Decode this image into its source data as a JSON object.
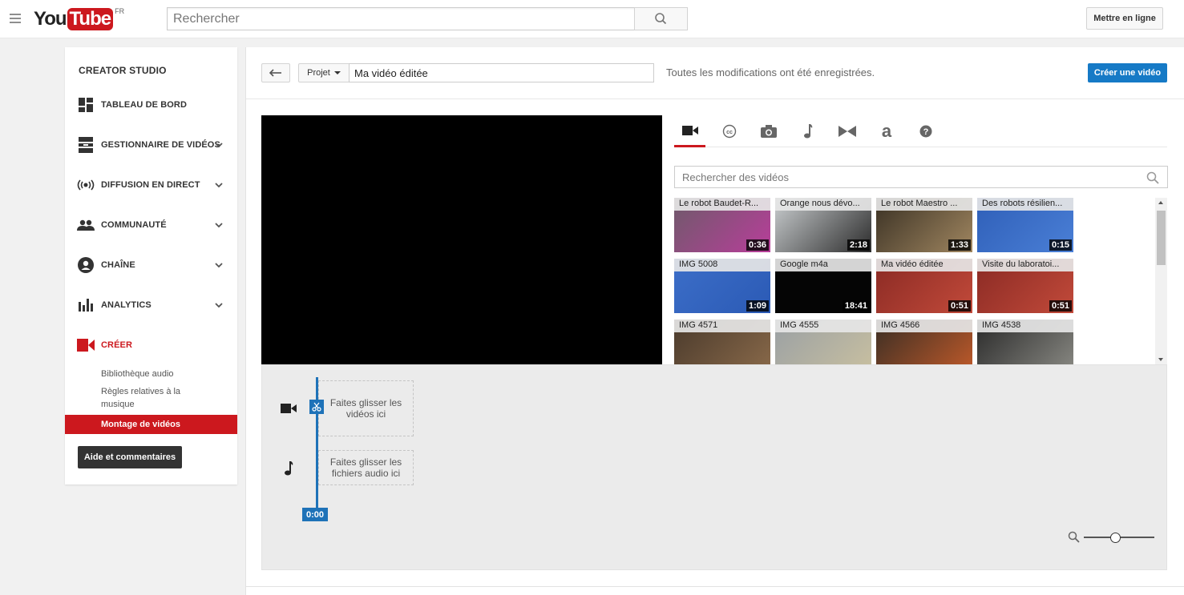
{
  "masthead": {
    "logo_you": "You",
    "logo_tube": "Tube",
    "logo_country": "FR",
    "search_placeholder": "Rechercher",
    "upload_label": "Mettre en ligne"
  },
  "sidebar": {
    "title": "CREATOR STUDIO",
    "items": [
      {
        "label": "TABLEAU DE BORD",
        "icon": "dashboard-icon",
        "has_chevron": false
      },
      {
        "label": "GESTIONNAIRE DE VIDÉOS",
        "icon": "video-manager-icon",
        "has_chevron": true
      },
      {
        "label": "DIFFUSION EN DIRECT",
        "icon": "live-broadcast-icon",
        "has_chevron": true
      },
      {
        "label": "COMMUNAUTÉ",
        "icon": "community-icon",
        "has_chevron": true
      },
      {
        "label": "CHAÎNE",
        "icon": "channel-icon",
        "has_chevron": true
      },
      {
        "label": "ANALYTICS",
        "icon": "analytics-icon",
        "has_chevron": true
      },
      {
        "label": "CRÉER",
        "icon": "create-video-icon",
        "has_chevron": false,
        "active": true
      }
    ],
    "sub_items": [
      {
        "label": "Bibliothèque audio"
      },
      {
        "label": "Règles relatives à la"
      },
      {
        "label": "musique"
      },
      {
        "label": "Montage de vidéos",
        "selected": true
      }
    ],
    "help_label": "Aide et commentaires"
  },
  "editor": {
    "project_label": "Projet",
    "title_value": "Ma vidéo éditée",
    "save_status": "Toutes les modifications ont été enregistrées.",
    "create_label": "Créer une vidéo",
    "tabs": [
      {
        "icon": "video-camera-icon",
        "active": true
      },
      {
        "icon": "creative-commons-icon"
      },
      {
        "icon": "photo-camera-icon"
      },
      {
        "icon": "music-note-icon"
      },
      {
        "icon": "transitions-icon"
      },
      {
        "icon": "text-icon"
      },
      {
        "icon": "help-icon"
      }
    ],
    "video_search_placeholder": "Rechercher des vidéos",
    "videos": [
      {
        "title": "Le robot Baudet-R...",
        "duration": "0:36",
        "colors": [
          "#6e5a6a",
          "#b83e9a"
        ]
      },
      {
        "title": "Orange nous dévo...",
        "duration": "2:18",
        "colors": [
          "#caced0",
          "#2c2c2c"
        ]
      },
      {
        "title": "Le robot Maestro ...",
        "duration": "1:33",
        "colors": [
          "#3a3124",
          "#a08660"
        ]
      },
      {
        "title": "Des robots résilien...",
        "duration": "0:15",
        "colors": [
          "#2f5fb8",
          "#4a7fd6"
        ]
      },
      {
        "title": "IMG 5008",
        "duration": "1:09",
        "colors": [
          "#3c6ec8",
          "#2b5ab5"
        ]
      },
      {
        "title": "Google m4a",
        "duration": "18:41",
        "colors": [
          "#050505",
          "#050505"
        ]
      },
      {
        "title": "Ma vidéo éditée",
        "duration": "0:51",
        "colors": [
          "#8a2a24",
          "#c24a3a"
        ]
      },
      {
        "title": "Visite du laboratoi...",
        "duration": "0:51",
        "colors": [
          "#8a2a24",
          "#c24a3a"
        ]
      },
      {
        "title": "IMG 4571",
        "duration": "",
        "colors": [
          "#4a3a2c",
          "#8a6a4a"
        ]
      },
      {
        "title": "IMG 4555",
        "duration": "",
        "colors": [
          "#9aa0a4",
          "#c9c0a0"
        ]
      },
      {
        "title": "IMG 4566",
        "duration": "",
        "colors": [
          "#3a2e24",
          "#c05a2a"
        ]
      },
      {
        "title": "IMG 4538",
        "duration": "",
        "colors": [
          "#2a2a2a",
          "#8a8a84"
        ]
      }
    ],
    "timeline": {
      "video_drop": "Faites glisser les vidéos ici",
      "audio_drop": "Faites glisser les fichiers audio ici",
      "playhead_time": "0:00",
      "zoom_level": 0.45
    }
  },
  "colors": {
    "brand_red": "#cc181e",
    "accent_blue": "#167ac6",
    "timeline_blue": "#1e72b8"
  }
}
